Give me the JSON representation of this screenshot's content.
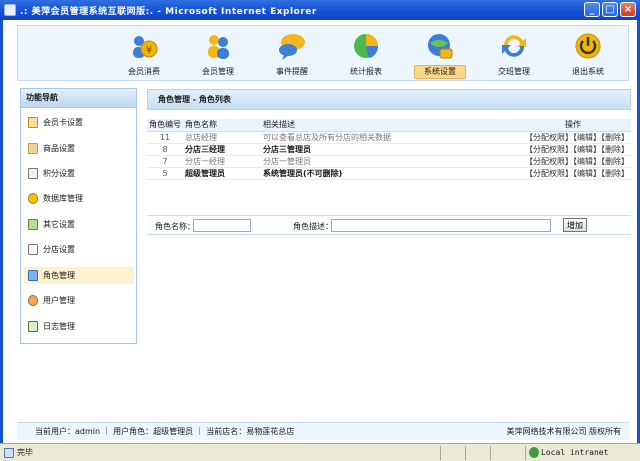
{
  "window": {
    "title": ".: 美萍会员管理系统互联网版:. - Microsoft Internet Explorer",
    "min_label": "_",
    "max_label": "□",
    "close_label": "×"
  },
  "topnav": {
    "items": [
      {
        "label": "会员消费",
        "icon": "coins-users-icon",
        "color": "#f0b400"
      },
      {
        "label": "会员管理",
        "icon": "users-icon",
        "color": "#4a8fe0"
      },
      {
        "label": "事件提醒",
        "icon": "chat-bubbles-icon",
        "color": "#f2b71c"
      },
      {
        "label": "统计报表",
        "icon": "pie-chart-icon",
        "color": "#4eb84a"
      },
      {
        "label": "系统设置",
        "icon": "globe-settings-icon",
        "color": "#3b7ed6"
      },
      {
        "label": "交班管理",
        "icon": "refresh-arrows-icon",
        "color": "#3b7ed6"
      },
      {
        "label": "退出系统",
        "icon": "power-icon",
        "color": "#f2b800"
      }
    ],
    "active_index": 4
  },
  "sidebar": {
    "title": "功能导航",
    "items": [
      {
        "label": "会员卡设置"
      },
      {
        "label": "商品设置"
      },
      {
        "label": "积分设置"
      },
      {
        "label": "数据库管理"
      },
      {
        "label": "其它设置"
      },
      {
        "label": "分店设置"
      },
      {
        "label": "角色管理"
      },
      {
        "label": "用户管理"
      },
      {
        "label": "日志管理"
      }
    ],
    "active_index": 6
  },
  "main": {
    "title": "角色管理 - 角色列表",
    "columns": [
      "角色编号",
      "角色名称",
      "相关描述",
      "操作"
    ],
    "rows": [
      {
        "id": "11",
        "name": "总店经理",
        "desc": "可以查看总店及所有分店的相关数据",
        "ops": "【分配权限】【编辑】【删除】"
      },
      {
        "id": "8",
        "name": "分店三经理",
        "desc": "分店三管理员",
        "ops": "【分配权限】【编辑】【删除】"
      },
      {
        "id": "7",
        "name": "分店一经理",
        "desc": "分店一管理员",
        "ops": "【分配权限】【编辑】【删除】"
      },
      {
        "id": "5",
        "name": "超级管理员",
        "desc": "系统管理员(不可删除)",
        "ops": "【分配权限】【编辑】【删除】"
      }
    ],
    "form": {
      "name_label": "角色名称：",
      "name_value": "",
      "desc_label": "角色描述：",
      "desc_value": "",
      "add_button": "增加"
    }
  },
  "footer": {
    "user_info": "当前用户：admin  ｜ 用户角色：超级管理员  ｜ 当前店名：易物莲花总店",
    "copyright": "美萍网络技术有限公司 版权所有"
  },
  "statusbar": {
    "status": "完毕",
    "zone": "Local intranet"
  }
}
